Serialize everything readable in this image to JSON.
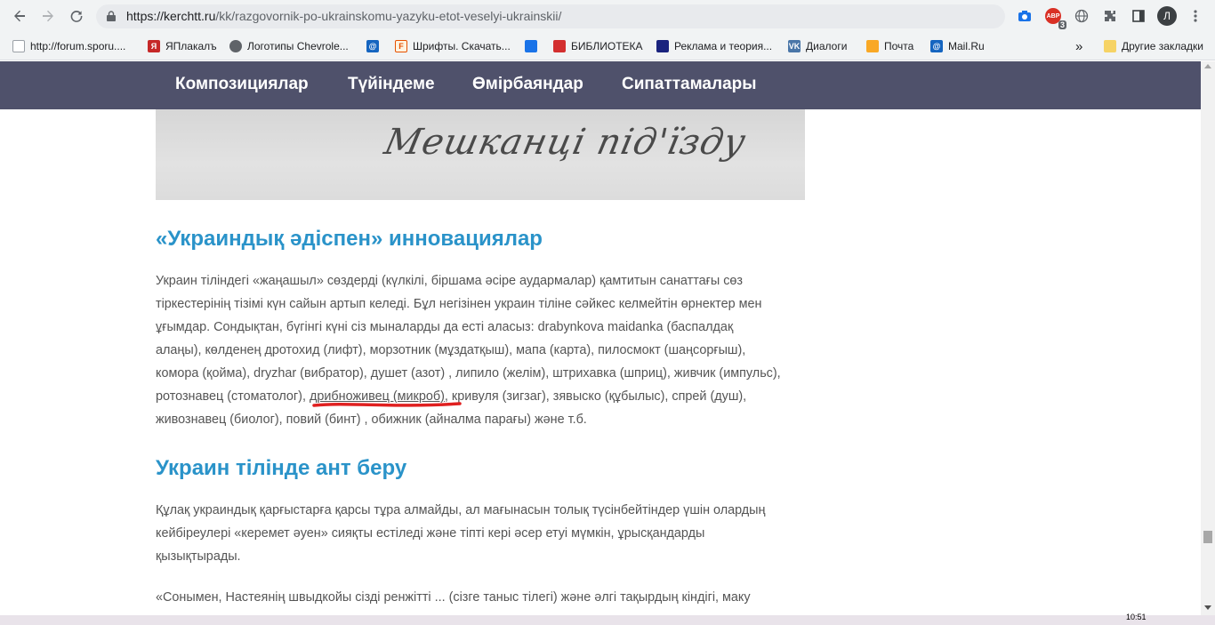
{
  "browser": {
    "url_host": "https://kerchtt.ru",
    "url_path": "/kk/razgovornik-po-ukrainskomu-yazyku-etot-veselyi-ukrainskii/",
    "abp_label": "ABP",
    "abp_badge": "3",
    "profile_initial": "Л",
    "bookmarks": [
      {
        "label": "http://forum.sporu....",
        "icon": "page-icon",
        "color": "#5f6368"
      },
      {
        "label": "ЯПлакалъ",
        "icon": "yaplakal-icon",
        "color": "#c62828"
      },
      {
        "label": "Логотипы Chevrole...",
        "icon": "globe-icon",
        "color": "#5f6368"
      },
      {
        "label": "Шрифты. Скачать...",
        "icon": "font-icon",
        "color": "#e65100"
      },
      {
        "label": "БИБЛИОТЕКА",
        "icon": "library-icon",
        "color": "#d32f2f"
      },
      {
        "label": "Реклама и теория...",
        "icon": "dark-site-icon",
        "color": "#1a237e"
      },
      {
        "label": "Диалоги",
        "icon": "vk-icon",
        "color": "#4a76a8"
      },
      {
        "label": "Почта",
        "icon": "mail-icon",
        "color": "#f9a825"
      },
      {
        "label": "Mail.Ru",
        "icon": "mailru-icon",
        "color": "#1565c0"
      }
    ],
    "more_bookmarks": "»",
    "other_bookmarks": "Другие закладки"
  },
  "site_nav": {
    "items": [
      "Композициялар",
      "Түйіндеме",
      "Өмірбаяндар",
      "Сипаттамалары"
    ],
    "background": "#4f516b"
  },
  "article": {
    "image_caption_script": "Мешканці під'їзду",
    "section1": {
      "heading": "«Украиндық әдіспен» инновациялар",
      "lines": [
        "Украин тіліндегі «жаңашыл» сөздерді (күлкілі, біршама әсіре аудармалар) қамтитын санаттағы сөз",
        "тіркестерінің тізімі күн сайын артып келеді. Бұл негізінен украин тіліне сәйкес келмейтін өрнектер мен",
        "ұғымдар. Сондықтан, бүгінгі күні сіз мыналарды да есті аласыз: drabynkova maidanka (баспалдақ",
        "алаңы), көлденең дротохид (лифт), морзотник (мұздатқыш), мапа (карта), пилосмокт (шаңсорғыш),",
        "комора (қойма), dryzhar (вибратор), душет (азот) , липило (желім), штрихавка (шприц), живчик (импульс),"
      ],
      "line6_before": "ротознавец (стоматолог), ",
      "line6_underlined": "дрибноживец (микроб)",
      "line6_after": ", кривуля (зигзаг), зявыско (құбылыс), спрей (душ),",
      "line7": "живознавец (биолог), повий (бинт) , обижник (айналма парағы) және т.б."
    },
    "section2": {
      "heading": "Украин тілінде ант беру",
      "lines": [
        "Құлақ украиндық қарғыстарға қарсы тұра алмайды, ал мағынасын толық түсінбейтіндер үшін олардың",
        "кейбіреулері «керемет әуен» сияқты естіледі және тіпті кері әсер етуі мүмкін, ұрысқандарды",
        "қызықтырады."
      ],
      "next_line": "«Сонымен, Настеянің швыдкойы сізді ренжітті ... (сізге таныс тілегі) және әлгі тақырдың кіндігі, маку"
    },
    "heading_color": "#2a93c9",
    "underline_mark_color": "#e02020"
  },
  "taskbar": {
    "time": "10:51"
  }
}
